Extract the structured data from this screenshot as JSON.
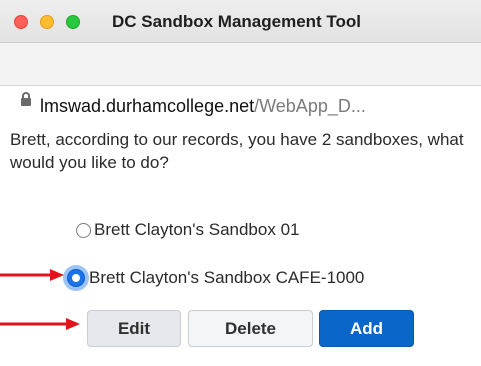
{
  "window": {
    "title": "DC Sandbox Management Tool",
    "traffic_lights": [
      "close",
      "minimize",
      "zoom"
    ]
  },
  "address_bar": {
    "domain": "lmswad.durhamcollege.net",
    "path": "/WebApp_D..."
  },
  "message": "Brett, according to our records, you have 2 sandboxes, what would you like to do?",
  "sandboxes": [
    {
      "label": "Brett Clayton's Sandbox 01",
      "selected": false
    },
    {
      "label": "Brett Clayton's Sandbox CAFE-1000",
      "selected": true
    }
  ],
  "buttons": {
    "edit": "Edit",
    "delete": "Delete",
    "add": "Add"
  },
  "colors": {
    "annotation_arrow": "#e0151b",
    "primary_button": "#0a66c9",
    "radio_selected": "#1a73e8"
  }
}
